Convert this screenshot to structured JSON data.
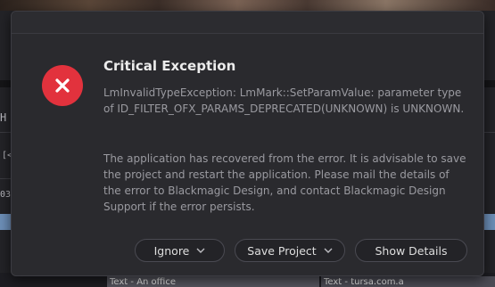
{
  "background": {
    "clip_left_label": "Text - An office",
    "clip_right_label": "Text - tursa.com.a",
    "side_glyph_left_1": "H",
    "side_glyph_left_2": "03",
    "side_glyph_left_3": "[<"
  },
  "dialog": {
    "title": "Critical Exception",
    "error_message": "LmInvalidTypeException: LmMark::SetParamValue: parameter type of ID_FILTER_OFX_PARAMS_DEPRECATED(UNKNOWN) is UNKNOWN.",
    "recovery_message": "The application has recovered from the error. It is advisable to save the project and restart the application. Please mail the details of the error to Blackmagic Design, and contact Blackmagic Design Support if the error persists.",
    "buttons": {
      "ignore": "Ignore",
      "save_project": "Save Project",
      "show_details": "Show Details"
    },
    "icon": "error-x-icon",
    "colors": {
      "icon_red": "#e2323d",
      "background": "#2a2a2e"
    }
  }
}
